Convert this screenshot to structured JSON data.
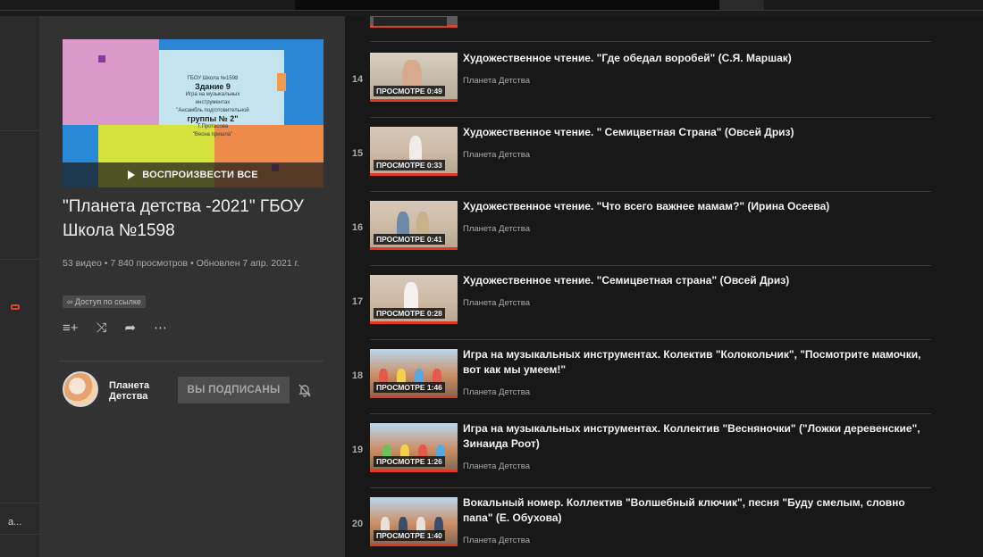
{
  "playlist": {
    "play_all_label": "ВОСПРОИЗВЕСТИ ВСЕ",
    "title": "\"Планета детства -2021\" ГБОУ Школа №1598",
    "stats": "53 видео • 7 840 просмотров • Обновлен 7 апр. 2021 г.",
    "access": "∞ Доступ по ссылке",
    "thumbnail_text": {
      "line1": "ГБОУ Школа №1598",
      "line2": "Здание 9",
      "line3": "Игра на музыкальных",
      "line4": "инструментах",
      "line5": "\"Ансамбль подготовительной",
      "line6": "группы № 2\"",
      "line7": "Т.Протасова",
      "line8": "\"Весна пришла\""
    },
    "actions": {
      "add_icon": "≡+",
      "shuffle_icon": "⤨",
      "share_icon": "➦",
      "more_icon": "⋯"
    }
  },
  "channel": {
    "name": "Планета Детства",
    "subscribe_label": "ВЫ ПОДПИСАНЫ"
  },
  "rail": {
    "text": "a..."
  },
  "videos": [
    {
      "index": "14",
      "overlay": "ПРОСМОТРЕ 0:49",
      "title": "Художественное чтение. \"Где обедал воробей\" (С.Я. Маршак)",
      "channel": "Планета Детства"
    },
    {
      "index": "15",
      "overlay": "ПРОСМОТРЕ 0:33",
      "title": "Художественное чтение. \" Семицветная Страна\" (Овсей Дриз)",
      "channel": "Планета Детства"
    },
    {
      "index": "16",
      "overlay": "ПРОСМОТРЕ 0:41",
      "title": "Художественное чтение. \"Что всего важнее мамам?\" (Ирина Осеева)",
      "channel": "Планета Детства"
    },
    {
      "index": "17",
      "overlay": "ПРОСМОТРЕ 0:28",
      "title": "Художественное чтение. \"Семицветная страна\" (Овсей Дриз)",
      "channel": "Планета Детства"
    },
    {
      "index": "18",
      "overlay": "ПРОСМОТРЕ 1:46",
      "title": "Игра на музыкальных инструментах. Колектив \"Колокольчик\", \"Посмотрите мамочки, вот как мы умеем!\"",
      "channel": "Планета Детства"
    },
    {
      "index": "19",
      "overlay": "ПРОСМОТРЕ 1:26",
      "title": "Игра на музыкальных инструментах. Коллектив \"Весняночки\" (\"Ложки деревенские\", Зинаида Роот)",
      "channel": "Планета Детства"
    },
    {
      "index": "20",
      "overlay": "ПРОСМОТРЕ 1:40",
      "title": "Вокальный номер. Коллектив \"Волшебный ключик\", песня \"Буду смелым, словно папа\" (Е. Обухова)",
      "channel": "Планета Детства"
    }
  ],
  "colors": {
    "accent_red": "#e03a26",
    "bg_list": "#181818",
    "bg_sidebar": "#323232"
  }
}
